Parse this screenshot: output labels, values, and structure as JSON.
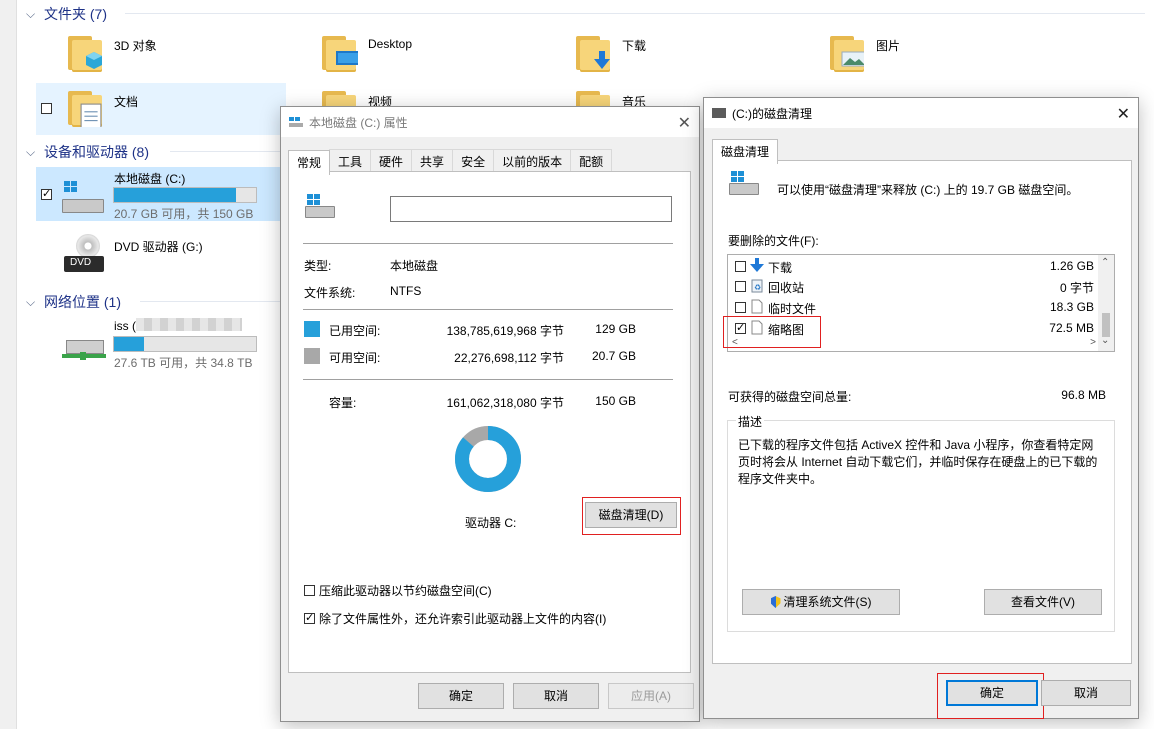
{
  "explorer": {
    "folders_group": "文件夹 (7)",
    "devices_group": "设备和驱动器 (8)",
    "network_group": "网络位置 (1)",
    "folders": [
      {
        "label": "3D 对象",
        "icon": "3d-objects-folder-icon"
      },
      {
        "label": "Desktop",
        "icon": "desktop-folder-icon"
      },
      {
        "label": "下载",
        "icon": "downloads-folder-icon"
      },
      {
        "label": "图片",
        "icon": "pictures-folder-icon"
      },
      {
        "label": "文档",
        "icon": "documents-folder-icon"
      },
      {
        "label": "视频",
        "icon": "videos-folder-icon"
      },
      {
        "label": "音乐",
        "icon": "music-folder-icon"
      }
    ],
    "local_disk": {
      "label": "本地磁盘 (C:)",
      "free": "20.7 GB 可用，共 150 GB",
      "used_fraction": 0.86
    },
    "dvd": {
      "label": "DVD 驱动器 (G:)",
      "badge": "DVD"
    },
    "network": {
      "label": "iss (",
      "free": "27.6 TB 可用，共 34.8 TB",
      "used_fraction": 0.21
    }
  },
  "properties": {
    "title": "本地磁盘 (C:) 属性",
    "tabs": [
      "常规",
      "工具",
      "硬件",
      "共享",
      "安全",
      "以前的版本",
      "配额"
    ],
    "name_value": "",
    "type_label": "类型:",
    "type_value": "本地磁盘",
    "fs_label": "文件系统:",
    "fs_value": "NTFS",
    "used_label": "已用空间:",
    "used_bytes": "138,785,619,968 字节",
    "used_gb": "129 GB",
    "free_label": "可用空间:",
    "free_bytes": "22,276,698,112 字节",
    "free_gb": "20.7 GB",
    "capacity_label": "容量:",
    "capacity_bytes": "161,062,318,080 字节",
    "capacity_gb": "150 GB",
    "drive_label": "驱动器 C:",
    "cleanup_button": "磁盘清理(D)",
    "compress_label": "压缩此驱动器以节约磁盘空间(C)",
    "index_label": "除了文件属性外，还允许索引此驱动器上文件的内容(I)",
    "ok": "确定",
    "cancel": "取消",
    "apply": "应用(A)",
    "used_fraction": 0.862,
    "colors": {
      "used": "#26a0da",
      "free": "#a8a8a8"
    }
  },
  "cleanup": {
    "title": "(C:)的磁盘清理",
    "tab": "磁盘清理",
    "intro": "可以使用“磁盘清理”来释放  (C:) 上的 19.7 GB 磁盘空间。",
    "files_label": "要删除的文件(F):",
    "files": [
      {
        "name": "下载",
        "size": "1.26 GB",
        "checked": false,
        "icon": "download-arrow-icon"
      },
      {
        "name": "回收站",
        "size": "0 字节",
        "checked": false,
        "icon": "recycle-bin-icon"
      },
      {
        "name": "临时文件",
        "size": "18.3 GB",
        "checked": false,
        "icon": "file-icon"
      },
      {
        "name": "缩略图",
        "size": "72.5 MB",
        "checked": true,
        "icon": "file-icon"
      }
    ],
    "total_label": "可获得的磁盘空间总量:",
    "total_value": "96.8 MB",
    "desc_title": "描述",
    "desc_text": "已下载的程序文件包括 ActiveX 控件和 Java 小程序，你查看特定网页时将会从 Internet 自动下载它们，并临时保存在硬盘上的已下载的程序文件夹中。",
    "clean_system_button": "清理系统文件(S)",
    "view_files_button": "查看文件(V)",
    "ok": "确定",
    "cancel": "取消"
  }
}
